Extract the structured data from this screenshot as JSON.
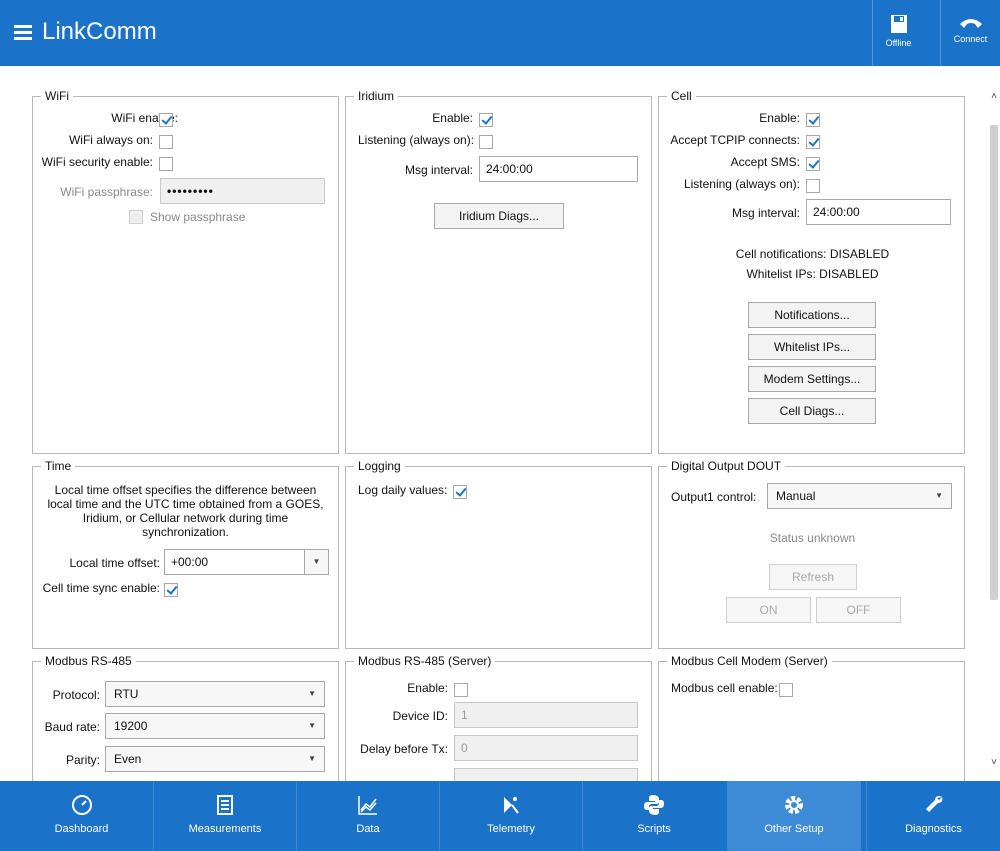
{
  "app": {
    "title": "LinkComm",
    "offline_label": "Offline",
    "connect_label": "Connect"
  },
  "wifi": {
    "legend": "WiFi",
    "enable_label": "WiFi enable:",
    "enable_checked": true,
    "always_on_label": "WiFi always on:",
    "always_on_checked": false,
    "security_label": "WiFi security enable:",
    "security_checked": false,
    "passphrase_label": "WiFi passphrase:",
    "passphrase_value": "•••••••••",
    "show_passphrase_label": "Show passphrase"
  },
  "iridium": {
    "legend": "Iridium",
    "enable_label": "Enable:",
    "enable_checked": true,
    "listening_label": "Listening (always on):",
    "listening_checked": false,
    "msg_interval_label": "Msg interval:",
    "msg_interval_value": "24:00:00",
    "diags_button": "Iridium Diags..."
  },
  "cell": {
    "legend": "Cell",
    "enable_label": "Enable:",
    "enable_checked": true,
    "tcpip_label": "Accept TCPIP connects:",
    "tcpip_checked": true,
    "sms_label": "Accept SMS:",
    "sms_checked": true,
    "listening_label": "Listening (always on):",
    "listening_checked": false,
    "msg_interval_label": "Msg interval:",
    "msg_interval_value": "24:00:00",
    "notifications_status": "Cell notifications: DISABLED",
    "whitelist_status": "Whitelist IPs: DISABLED",
    "notifications_button": "Notifications...",
    "whitelist_button": "Whitelist IPs...",
    "modem_button": "Modem Settings...",
    "diags_button": "Cell Diags..."
  },
  "time": {
    "legend": "Time",
    "description": "Local time offset specifies the difference between local time and the UTC time obtained from a GOES, Iridium, or Cellular network during time synchronization.",
    "offset_label": "Local time offset:",
    "offset_value": "+00:00",
    "sync_label": "Cell time sync enable:",
    "sync_checked": true
  },
  "logging": {
    "legend": "Logging",
    "daily_label": "Log daily values:",
    "daily_checked": true
  },
  "dout": {
    "legend": "Digital Output DOUT",
    "control_label": "Output1 control:",
    "control_value": "Manual",
    "status": "Status unknown",
    "refresh_button": "Refresh",
    "on_button": "ON",
    "off_button": "OFF"
  },
  "modbus": {
    "legend": "Modbus RS-485",
    "protocol_label": "Protocol:",
    "protocol_value": "RTU",
    "baud_label": "Baud rate:",
    "baud_value": "19200",
    "parity_label": "Parity:",
    "parity_value": "Even"
  },
  "modbus_server": {
    "legend": "Modbus RS-485 (Server)",
    "enable_label": "Enable:",
    "enable_checked": false,
    "device_id_label": "Device ID:",
    "device_id_value": "1",
    "delay_label": "Delay before Tx:",
    "delay_value": "0"
  },
  "modbus_cell": {
    "legend": "Modbus Cell Modem (Server)",
    "enable_label": "Modbus cell enable:",
    "enable_checked": false
  },
  "nav": [
    {
      "label": "Dashboard",
      "icon": "dashboard-icon"
    },
    {
      "label": "Measurements",
      "icon": "measurements-icon"
    },
    {
      "label": "Data",
      "icon": "data-icon"
    },
    {
      "label": "Telemetry",
      "icon": "telemetry-icon"
    },
    {
      "label": "Scripts",
      "icon": "scripts-icon"
    },
    {
      "label": "Other Setup",
      "icon": "other-setup-icon"
    },
    {
      "label": "Diagnostics",
      "icon": "diagnostics-icon"
    }
  ],
  "colors": {
    "brand": "#1a72c9",
    "active_nav": "#3d8ad6",
    "check": "#1a72c9"
  }
}
